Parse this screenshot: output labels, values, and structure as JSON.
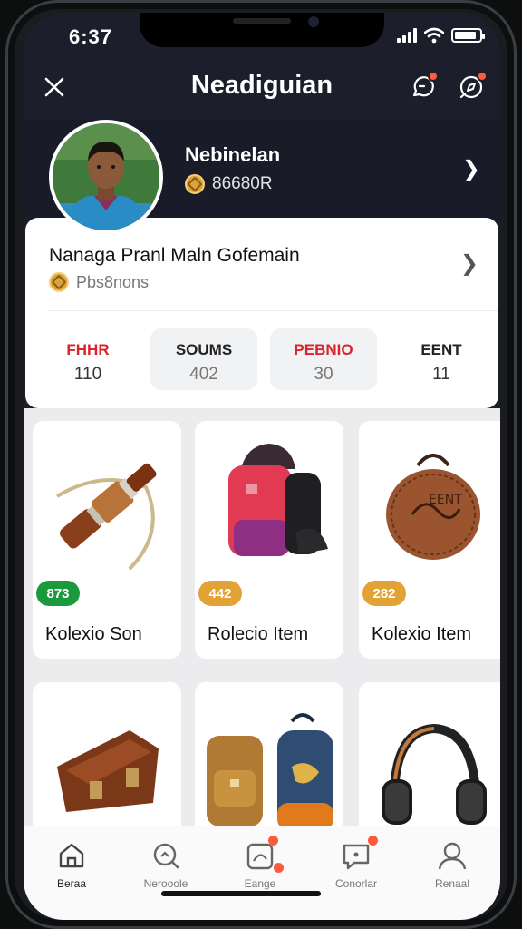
{
  "status_bar": {
    "time": "6:37"
  },
  "header": {
    "title": "Neadiguian",
    "close_icon": "close-icon",
    "notification_icon": "chat-alert-icon",
    "settings_icon": "compass-icon"
  },
  "profile": {
    "name": "Nebinelan",
    "sub_value": "86680R",
    "coin_icon": "coin-icon"
  },
  "card": {
    "title": "Nanaga Pranl Maln Gofemain",
    "subtitle": "Pbs8nons",
    "stats": [
      {
        "label": "FHHR",
        "value": "110",
        "accent": "#d8242a"
      },
      {
        "label": "SOUMS",
        "value": "402",
        "accent": "#222222"
      },
      {
        "label": "PEBNIO",
        "value": "30",
        "accent": "#d8242a"
      },
      {
        "label": "EENT",
        "value": "11",
        "accent": "#222222"
      }
    ]
  },
  "items": [
    {
      "name": "Kolexio Son",
      "badge": "873",
      "badge_color": "#1a9a3c",
      "icon": "spyglass-icon"
    },
    {
      "name": "Rolecio Item",
      "badge": "442",
      "badge_color": "#e3a235",
      "icon": "backpack-icon"
    },
    {
      "name": "Kolexio Item",
      "badge": "282",
      "badge_color": "#e3a235",
      "icon": "leather-pouch-icon"
    },
    {
      "name": "",
      "badge": "",
      "badge_color": "#e3a235",
      "icon": "leather-bag-icon"
    },
    {
      "name": "",
      "badge": "",
      "badge_color": "#e3a235",
      "icon": "backpacks-icon"
    },
    {
      "name": "",
      "badge": "",
      "badge_color": "#e3a235",
      "icon": "headphones-icon"
    }
  ],
  "nav": [
    {
      "label": "Beraa",
      "icon": "home-icon",
      "active": true
    },
    {
      "label": "Nerooole",
      "icon": "search-icon",
      "active": false
    },
    {
      "label": "Eange",
      "icon": "photo-badge-icon",
      "active": false
    },
    {
      "label": "Conorlar",
      "icon": "chat-icon",
      "active": false
    },
    {
      "label": "Renaal",
      "icon": "user-icon",
      "active": false
    }
  ]
}
